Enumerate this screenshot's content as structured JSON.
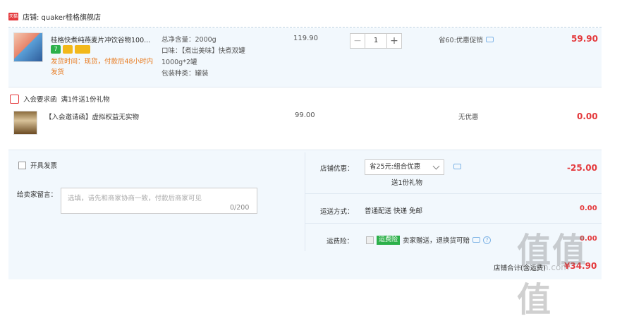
{
  "shop": {
    "badge": "天猫",
    "name": "店铺: quaker桂格旗舰店"
  },
  "item1": {
    "title": "桂格快煮纯燕麦片冲饮谷物100...",
    "tag_a": "7",
    "ship_note": "发货时间：现货，付款后48小时内发货",
    "spec_weight": "总净含量：2000g",
    "spec_flavor": "口味：【煮出美味】快煮双罐1000g*2罐",
    "spec_pack": "包装种类：罐装",
    "price": "119.90",
    "qty": "1",
    "qty_minus": "−",
    "qty_plus": "+",
    "promo": "省60:优惠促销",
    "total": "59.90"
  },
  "gift": {
    "label": "入会要求函",
    "desc": "满1件送1份礼物"
  },
  "item2": {
    "title": "【入会邀请函】虚拟权益无实物",
    "price": "99.00",
    "promo": "无优惠",
    "total": "0.00"
  },
  "invoice": {
    "label": "开具发票"
  },
  "message": {
    "label": "给卖家留言：",
    "placeholder": "选填，请先和商家协商一致，付款后商家可见",
    "count": "0/200"
  },
  "shop_discount": {
    "label": "店铺优惠：",
    "selected": "省25元:组合优惠",
    "note": "送1份礼物",
    "amount": "-25.00"
  },
  "shipping": {
    "label": "运送方式：",
    "value": "普通配送 快递 免邮",
    "amount": "0.00"
  },
  "insurance": {
    "label": "运费险：",
    "badge": "运费险",
    "desc": "卖家赠送，退换货可赔",
    "amount": "0.00"
  },
  "summary": {
    "label": "店铺合计(含运费)",
    "amount": "¥34.90"
  },
  "watermark": {
    "text": "值值值",
    "url": "smzdm.com"
  },
  "colors": {
    "accent_red": "#e4393c",
    "ship_orange": "#e87a1e",
    "bg_blue": "#f2f8fd"
  }
}
